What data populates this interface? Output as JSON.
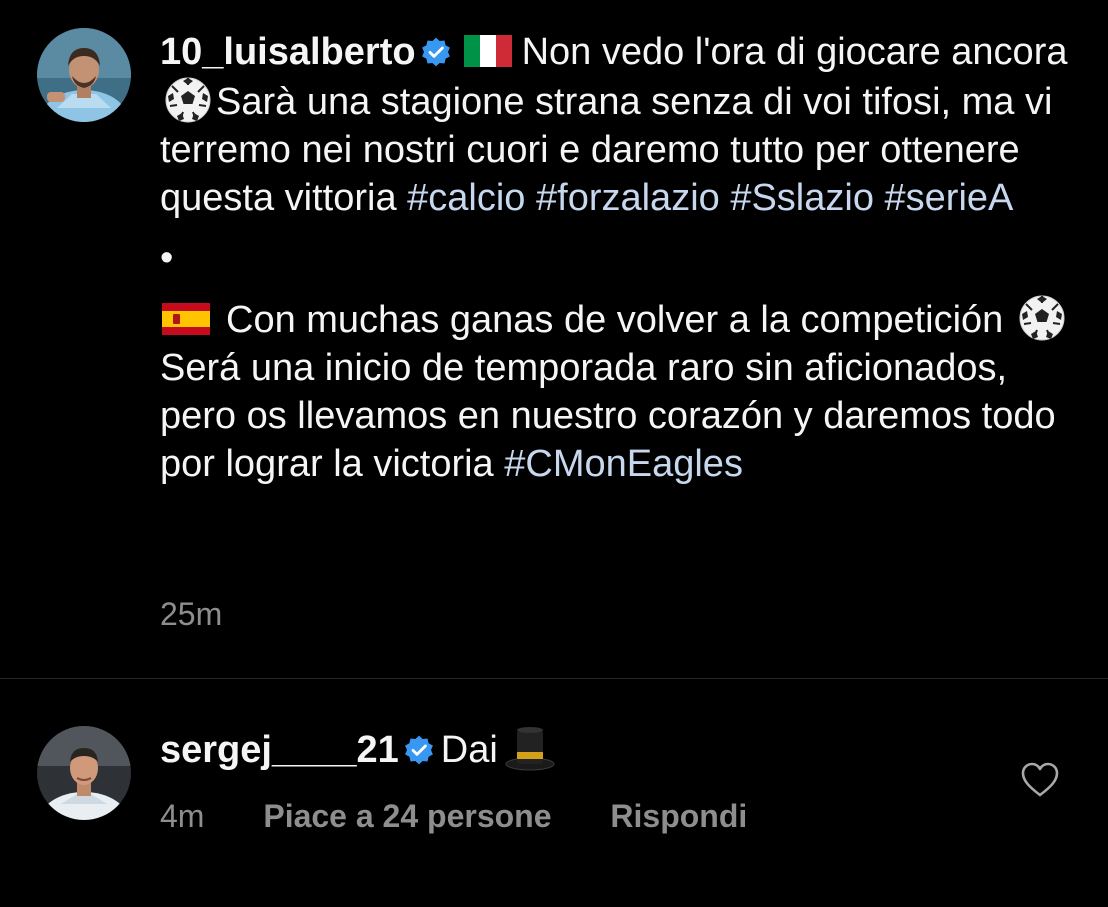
{
  "post": {
    "username": "10_luisalberto",
    "caption_it_1": "Non vedo l'ora di giocare ancora",
    "caption_it_2": "Sarà una stagione strana senza di voi tifosi, ma vi terremo nei nostri cuori e daremo tutto per ottenere questa vittoria",
    "hashtags_it": [
      "#calcio",
      "#forzalazio",
      "#Sslazio",
      "#serieA"
    ],
    "separator": "•",
    "caption_es_1": "Con muchas ganas de volver a la competición",
    "caption_es_2": "Será una inicio de temporada raro sin aficionados, pero os llevamos en nuestro corazón y daremos todo por lograr la victoria",
    "hashtag_es": "#CMonEagles",
    "time": "25m"
  },
  "comment": {
    "username": "sergej____21",
    "text": "Dai",
    "time": "4m",
    "likes_label": "Piace a 24 persone",
    "reply_label": "Rispondi"
  },
  "icons": {
    "verified": "verified-badge-icon",
    "flag_it": "italy-flag-icon",
    "flag_es": "spain-flag-icon",
    "ball": "soccer-ball-icon",
    "hat": "top-hat-icon",
    "heart": "heart-outline-icon"
  },
  "colors": {
    "background": "#000000",
    "text": "#f5f5f5",
    "secondary": "#8e8e8e",
    "hashtag": "#c7d7ee",
    "verified": "#3897f0",
    "divider": "#262626"
  }
}
